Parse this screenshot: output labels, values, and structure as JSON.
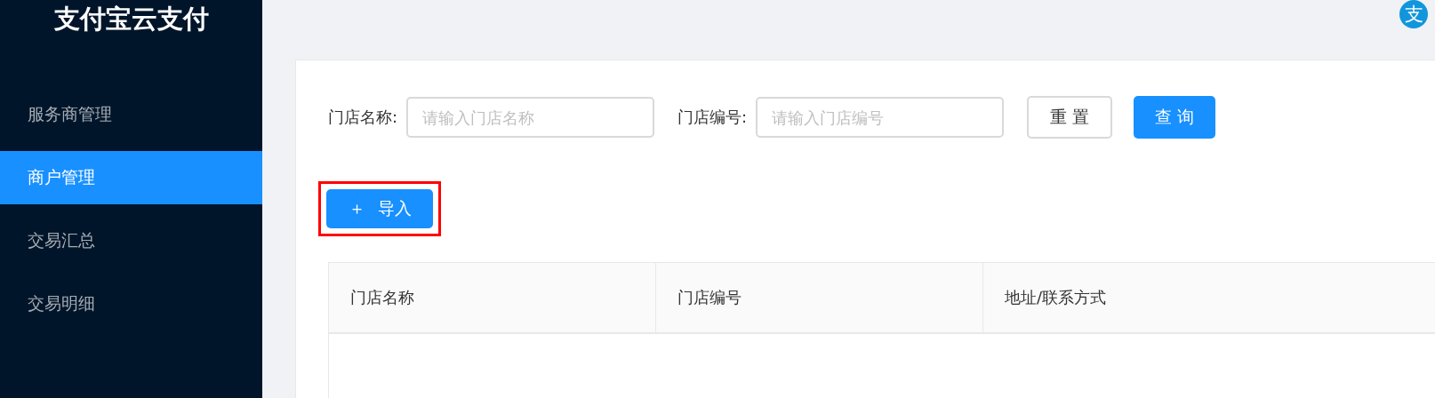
{
  "sidebar": {
    "title": "支付宝云支付",
    "items": [
      {
        "label": "服务商管理",
        "selected": false
      },
      {
        "label": "商户管理",
        "selected": true
      },
      {
        "label": "交易汇总",
        "selected": false
      },
      {
        "label": "交易明细",
        "selected": false
      }
    ]
  },
  "header": {
    "logo": "支"
  },
  "filters": [
    {
      "label": "门店名称:",
      "placeholder": "请输入门店名称"
    },
    {
      "label": "门店编号:",
      "placeholder": "请输入门店编号"
    }
  ],
  "buttons": [
    {
      "label": "重 置",
      "kind": "default"
    },
    {
      "label": "查 询",
      "kind": "primary"
    }
  ],
  "import_button": {
    "icon": "＋",
    "label": "导入",
    "highlighted": true
  },
  "table": {
    "columns": [
      "门店名称",
      "门店编号",
      "地址/联系方式"
    ]
  }
}
